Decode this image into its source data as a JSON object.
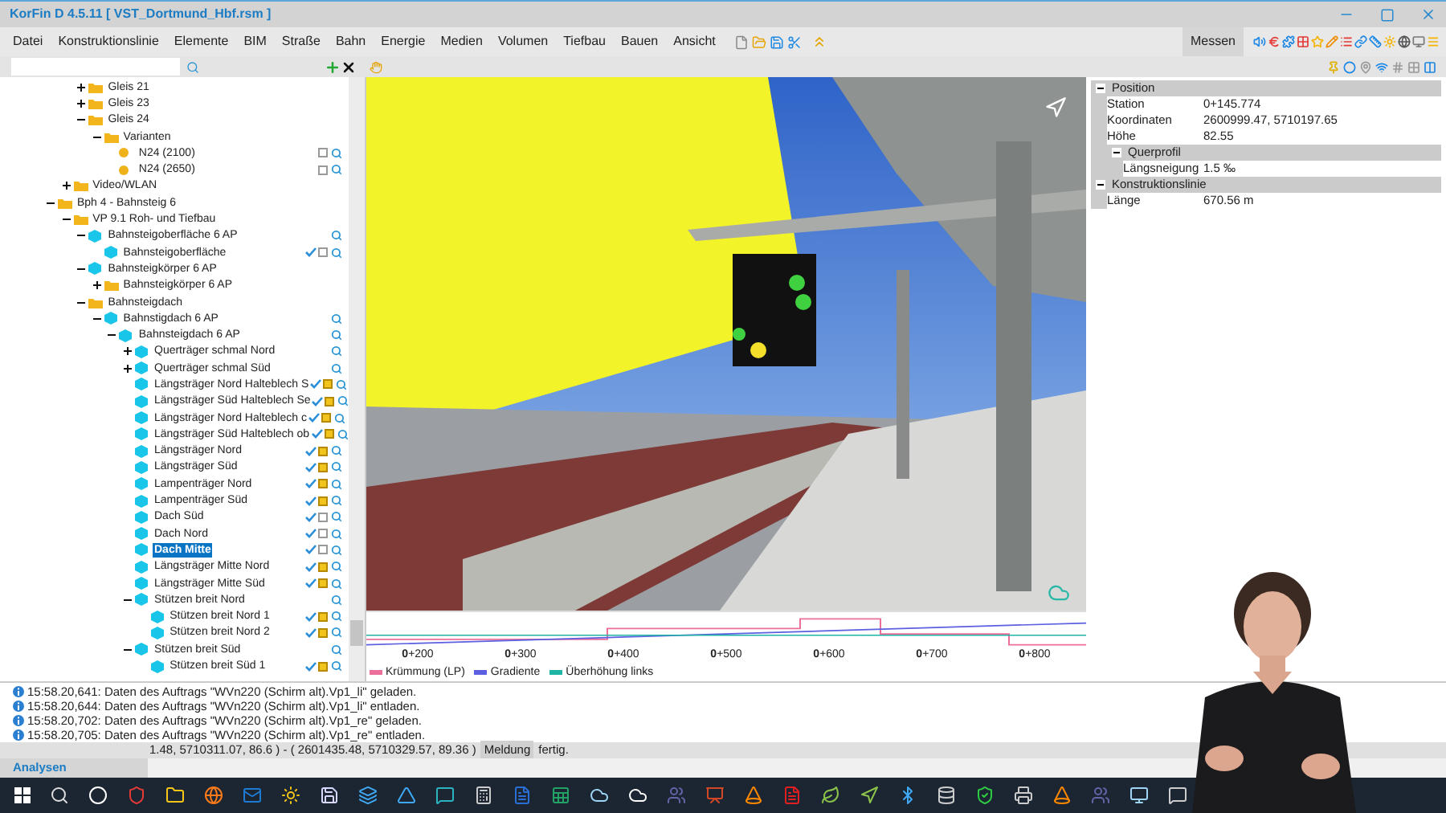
{
  "window": {
    "title": "KorFin D 4.5.11 [ VST_Dortmund_Hbf.rsm ]"
  },
  "menu": [
    "Datei",
    "Konstruktionslinie",
    "Elemente",
    "BIM",
    "Straße",
    "Bahn",
    "Energie",
    "Medien",
    "Volumen",
    "Tiefbau",
    "Bauen",
    "Ansicht"
  ],
  "measure_tab": {
    "label": "Messen"
  },
  "tree": [
    {
      "children": [
        {
          "children": [
            {
              "label": "Gleis 21",
              "kind": "folder",
              "expanded": false,
              "selected": false
            },
            {
              "label": "Gleis 23",
              "kind": "folder",
              "expanded": false,
              "selected": false
            },
            {
              "label": "Gleis 24",
              "kind": "folder",
              "expanded": true,
              "selected": false,
              "children": [
                {
                  "label": "Varianten",
                  "kind": "folder",
                  "expanded": true,
                  "selected": false,
                  "children": [
                    {
                      "label": "N24 (2100)",
                      "kind": "dot",
                      "selected": false,
                      "marked": false,
                      "search": true
                    },
                    {
                      "label": "N24 (2650)",
                      "kind": "dot",
                      "selected": false,
                      "marked": false,
                      "search": true
                    }
                  ]
                }
              ]
            }
          ]
        },
        {
          "label": "Video/WLAN",
          "kind": "folder",
          "expanded": false,
          "selected": false
        }
      ]
    },
    {
      "label": "Bph 4 - Bahnsteig 6",
      "kind": "folder",
      "expanded": true,
      "selected": false,
      "children": [
        {
          "label": "VP 9.1 Roh- und Tiefbau",
          "kind": "folder",
          "expanded": true,
          "selected": false,
          "children": [
            {
              "label": "Bahnsteigoberfläche 6 AP",
              "kind": "cube",
              "expanded": true,
              "selected": false,
              "search": true,
              "children": [
                {
                  "label": "Bahnsteigoberfläche",
                  "kind": "cube",
                  "selected": false,
                  "tick": true,
                  "marked": false,
                  "search": true
                }
              ]
            },
            {
              "label": "Bahnsteigkörper 6 AP",
              "kind": "cube",
              "expanded": true,
              "selected": false,
              "children": [
                {
                  "label": "Bahnsteigkörper 6 AP",
                  "kind": "folder",
                  "expanded": false,
                  "selected": false
                }
              ]
            },
            {
              "label": "Bahnsteigdach",
              "kind": "folder",
              "expanded": true,
              "selected": false,
              "children": [
                {
                  "label": "Bahnstigdach 6 AP",
                  "kind": "cube",
                  "expanded": true,
                  "selected": false,
                  "search": true,
                  "children": [
                    {
                      "label": "Bahnsteigdach 6 AP",
                      "kind": "cube",
                      "expanded": true,
                      "selected": false,
                      "search": true,
                      "children": [
                        {
                          "label": "Querträger schmal Nord",
                          "kind": "cube",
                          "expanded": false,
                          "selected": false,
                          "search": true
                        },
                        {
                          "label": "Querträger schmal Süd",
                          "kind": "cube",
                          "expanded": false,
                          "selected": false,
                          "search": true
                        },
                        {
                          "label": "Längsträger Nord Halteblech S",
                          "kind": "cube",
                          "selected": false,
                          "tick": true,
                          "marked": true,
                          "search": true
                        },
                        {
                          "label": "Längsträger Süd Halteblech Se",
                          "kind": "cube",
                          "selected": false,
                          "tick": true,
                          "marked": true,
                          "search": true
                        },
                        {
                          "label": "Längsträger Nord Halteblech c",
                          "kind": "cube",
                          "selected": false,
                          "tick": true,
                          "marked": true,
                          "search": true
                        },
                        {
                          "label": "Längsträger Süd Halteblech ob",
                          "kind": "cube",
                          "selected": false,
                          "tick": true,
                          "marked": true,
                          "search": true
                        },
                        {
                          "label": "Längsträger Nord",
                          "kind": "cube",
                          "selected": false,
                          "tick": true,
                          "marked": true,
                          "search": true
                        },
                        {
                          "label": "Längsträger Süd",
                          "kind": "cube",
                          "selected": false,
                          "tick": true,
                          "marked": true,
                          "search": true
                        },
                        {
                          "label": "Lampenträger Nord",
                          "kind": "cube",
                          "selected": false,
                          "tick": true,
                          "marked": true,
                          "search": true
                        },
                        {
                          "label": "Lampenträger Süd",
                          "kind": "cube",
                          "selected": false,
                          "tick": true,
                          "marked": true,
                          "search": true
                        },
                        {
                          "label": "Dach Süd",
                          "kind": "cube",
                          "selected": false,
                          "tick": true,
                          "marked": false,
                          "search": true
                        },
                        {
                          "label": "Dach Nord",
                          "kind": "cube",
                          "selected": false,
                          "tick": true,
                          "marked": false,
                          "search": true
                        },
                        {
                          "label": "Dach Mitte",
                          "kind": "cube",
                          "selected": true,
                          "tick": true,
                          "marked": false,
                          "search": true
                        },
                        {
                          "label": "Längsträger Mitte Nord",
                          "kind": "cube",
                          "selected": false,
                          "tick": true,
                          "marked": true,
                          "search": true
                        },
                        {
                          "label": "Längsträger Mitte Süd",
                          "kind": "cube",
                          "selected": false,
                          "tick": true,
                          "marked": true,
                          "search": true
                        },
                        {
                          "label": "Stützen breit Nord",
                          "kind": "cube",
                          "expanded": true,
                          "selected": false,
                          "search": true,
                          "children": [
                            {
                              "label": "Stützen breit Nord 1",
                              "kind": "cube",
                              "selected": false,
                              "tick": true,
                              "marked": true,
                              "search": true
                            },
                            {
                              "label": "Stützen breit Nord 2",
                              "kind": "cube",
                              "selected": false,
                              "tick": true,
                              "marked": true,
                              "search": true
                            }
                          ]
                        },
                        {
                          "label": "Stützen breit Süd",
                          "kind": "cube",
                          "expanded": true,
                          "selected": false,
                          "search": true,
                          "children": [
                            {
                              "label": "Stützen breit Süd 1",
                              "kind": "cube",
                              "selected": false,
                              "tick": true,
                              "marked": true,
                              "search": true
                            }
                          ]
                        }
                      ]
                    }
                  ]
                }
              ]
            }
          ]
        }
      ]
    }
  ],
  "properties": [
    {
      "label": "Position",
      "expanded": true,
      "rows": [
        {
          "name": "Station",
          "value": "0+145.774"
        },
        {
          "name": "Koordinaten",
          "value": "2600999.47, 5710197.65"
        },
        {
          "name": "Höhe",
          "value": "82.55"
        }
      ],
      "groups": [
        {
          "label": "Querprofil",
          "expanded": true,
          "rows": [
            {
              "name": "Längsneigung",
              "value": "1.5 ‰"
            }
          ]
        }
      ]
    },
    {
      "label": "Konstruktionslinie",
      "expanded": true,
      "rows": [
        {
          "name": "Länge",
          "value": "670.56 m"
        }
      ]
    }
  ],
  "profile": {
    "axis_labels": [
      "**0**+200",
      "**0**+300",
      "**0**+400",
      "**0**+500",
      "**0**+600",
      "**0**+700",
      "**0**+800"
    ],
    "legend": [
      {
        "label": "Krümmung (LP)",
        "color": "#ec6f9b"
      },
      {
        "label": "Gradiente",
        "color": "#5b5fe0"
      },
      {
        "label": "Überhöhung links",
        "color": "#1fb5a5"
      }
    ]
  },
  "log": [
    "15:58.20,641: Daten des Auftrags \"WVn220 (Schirm alt).Vp1_li\" geladen.",
    "15:58.20,644: Daten des Auftrags \"WVn220 (Schirm alt).Vp1_li\" entladen.",
    "15:58.20,702: Daten des Auftrags \"WVn220 (Schirm alt).Vp1_re\" geladen.",
    "15:58.20,705: Daten des Auftrags \"WVn220 (Schirm alt).Vp1_re\" entladen."
  ],
  "status_bar": {
    "coordinates": "1.48, 5710311.07, 86.6 ) - ( 2601435.48, 5710329.57, 89.36 )",
    "label": "Meldung",
    "message": "fertig."
  },
  "bottom_tab": {
    "label": "Analysen"
  }
}
